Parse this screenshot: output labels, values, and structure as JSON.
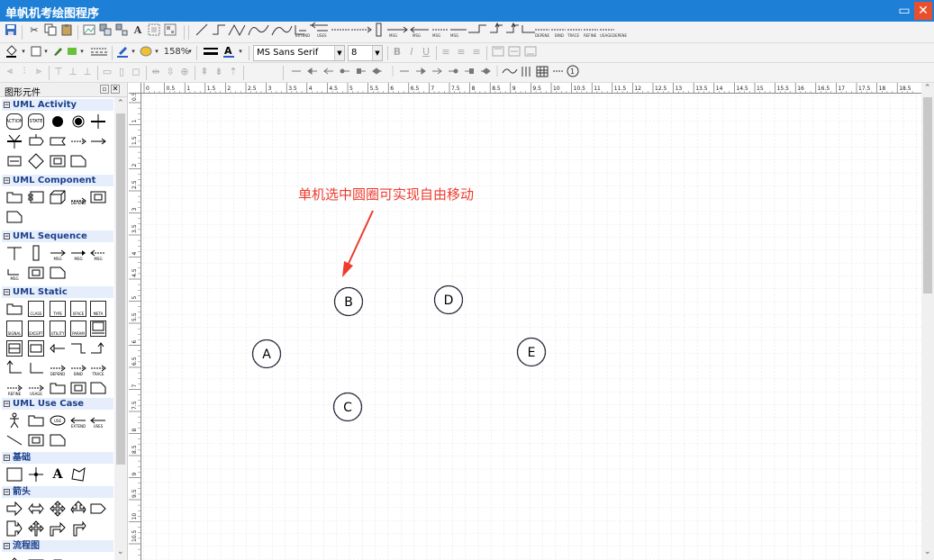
{
  "window": {
    "title": "单帆机考绘图程序",
    "maximize_icon": "maximize-icon",
    "close_icon": "close-icon"
  },
  "toolbar_format": {
    "zoom": "158%",
    "font_family": "MS Sans Serif",
    "font_size": "8"
  },
  "connector_labels": [
    "EXTEND",
    "USES",
    "MSG",
    "MSG",
    "MSG",
    "MSG",
    "DEPEND",
    "BIND",
    "TRACE",
    "REFINE",
    "USAGE",
    "DEPENDE"
  ],
  "palette": {
    "title": "图形元件",
    "sections": [
      {
        "name": "UML Activity",
        "shape_labels": [
          "ACTION",
          "STATE"
        ]
      },
      {
        "name": "UML Component",
        "shape_labels": [
          "DEPEND"
        ]
      },
      {
        "name": "UML Sequence",
        "shape_labels": [
          "MSG",
          "MSG",
          "MSG",
          "MSG"
        ]
      },
      {
        "name": "UML Static",
        "shape_labels": [
          "CLASS",
          "TYPE",
          "I/FACE",
          "META",
          "SIGNAL",
          "EXCEPT",
          "UTILITY",
          "PARAM",
          "DEPEND",
          "BIND",
          "TRACE",
          "REFINE",
          "USAGE"
        ]
      },
      {
        "name": "UML Use Case",
        "shape_labels": [
          "USE",
          "EXTEND",
          "USES"
        ]
      },
      {
        "name": "基础",
        "shape_labels": [
          "A"
        ]
      },
      {
        "name": "箭头",
        "shape_labels": []
      },
      {
        "name": "流程图",
        "shape_labels": []
      }
    ]
  },
  "ruler": {
    "h_labels": [
      "0",
      "0.5",
      "1",
      "1.5",
      "2",
      "2.5",
      "3",
      "3.5",
      "4",
      "4.5",
      "5",
      "5.5",
      "6",
      "6.5",
      "7",
      "7.5",
      "8",
      "8.5",
      "9",
      "9.5",
      "10",
      "10.5",
      "11",
      "11.5",
      "12",
      "12.5",
      "13",
      "13.5",
      "14",
      "14.5",
      "15",
      "15.5",
      "16",
      "16.5",
      "17",
      "17.5",
      "18",
      "18.5"
    ],
    "v_labels": [
      "0.5",
      "1",
      "1.5",
      "2",
      "2.5",
      "3",
      "3.5",
      "4",
      "4.5",
      "5",
      "5.5",
      "6",
      "6.5",
      "7",
      "7.5",
      "8",
      "8.5",
      "9",
      "9.5",
      "10",
      "10.5"
    ]
  },
  "canvas": {
    "annotation": "单机选中圆圈可实现自由移动",
    "annotation_color": "#ee3b2e",
    "nodes": [
      {
        "label": "A"
      },
      {
        "label": "B"
      },
      {
        "label": "C"
      },
      {
        "label": "D"
      },
      {
        "label": "E"
      }
    ]
  },
  "colors": {
    "title_bar": "#1e7fd6",
    "close_button": "#e8502d",
    "section_header": "#1c3f8c"
  }
}
